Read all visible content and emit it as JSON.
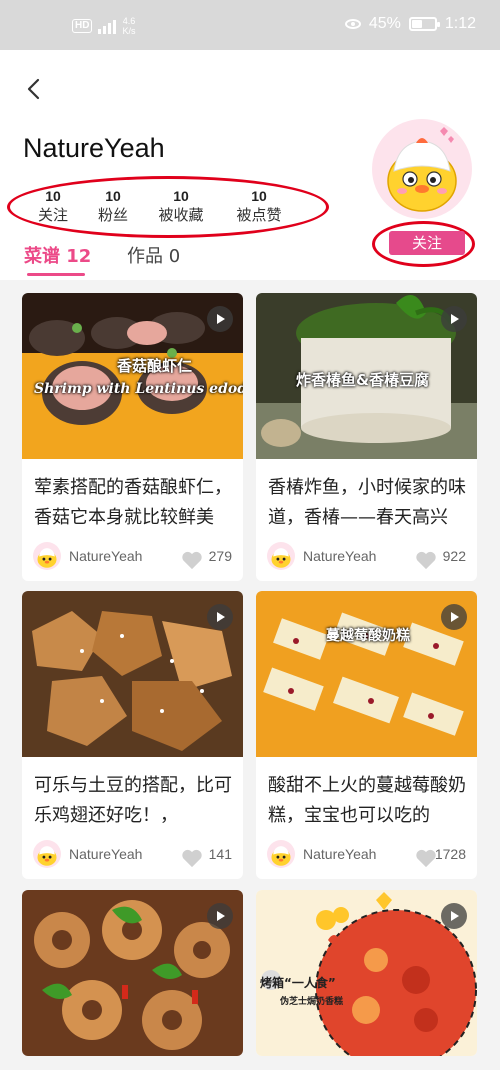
{
  "status_bar": {
    "network": "HD",
    "speed_value": "4.6",
    "speed_unit": "K/s",
    "battery_percent": "45%",
    "battery_level": 0.45,
    "time": "1:12"
  },
  "profile": {
    "username": "NatureYeah",
    "stats": [
      {
        "value": "10",
        "label": "关注"
      },
      {
        "value": "10",
        "label": "粉丝"
      },
      {
        "value": "10",
        "label": "被收藏"
      },
      {
        "value": "10",
        "label": "被点赞"
      }
    ],
    "follow_label": "关注"
  },
  "tabs": [
    {
      "label": "菜谱 12",
      "active": true
    },
    {
      "label": "作品 0",
      "active": false
    }
  ],
  "cards": [
    {
      "title": "荤素搭配的香菇酿虾仁，香菇它本身就比较鲜美",
      "overlay": "香菇酿虾仁",
      "overlay2": "Shrimp with Lentinus edodes",
      "author": "NatureYeah",
      "likes": "279",
      "icon": "play-icon"
    },
    {
      "title": "香椿炸鱼，小时候家的味道，香椿——春天高兴",
      "overlay": "炸香椿鱼&香椿豆腐",
      "overlay2": "",
      "author": "NatureYeah",
      "likes": "922",
      "icon": "play-icon"
    },
    {
      "title": "可乐与土豆的搭配，比可乐鸡翅还好吃！，",
      "overlay": "",
      "overlay2": "",
      "author": "NatureYeah",
      "likes": "141",
      "icon": "play-icon"
    },
    {
      "title": "酸甜不上火的蔓越莓酸奶糕，宝宝也可以吃的",
      "overlay": "蔓越莓酸奶糕",
      "overlay2": "",
      "author": "NatureYeah",
      "likes": "1728",
      "icon": "play-icon"
    },
    {
      "title": "",
      "overlay": "",
      "overlay2": "",
      "author": "",
      "likes": "",
      "icon": "play-icon"
    },
    {
      "title": "",
      "overlay": "烤箱“一人食”",
      "overlay2": "伪芝士焗奶香糕",
      "author": "",
      "likes": "",
      "icon": "play-icon"
    }
  ],
  "colors": {
    "accent": "#ec4a88",
    "follow_button": "#e64a8c",
    "annotation_red": "#e0001b",
    "status_bar_bg": "#d9d9d9"
  }
}
